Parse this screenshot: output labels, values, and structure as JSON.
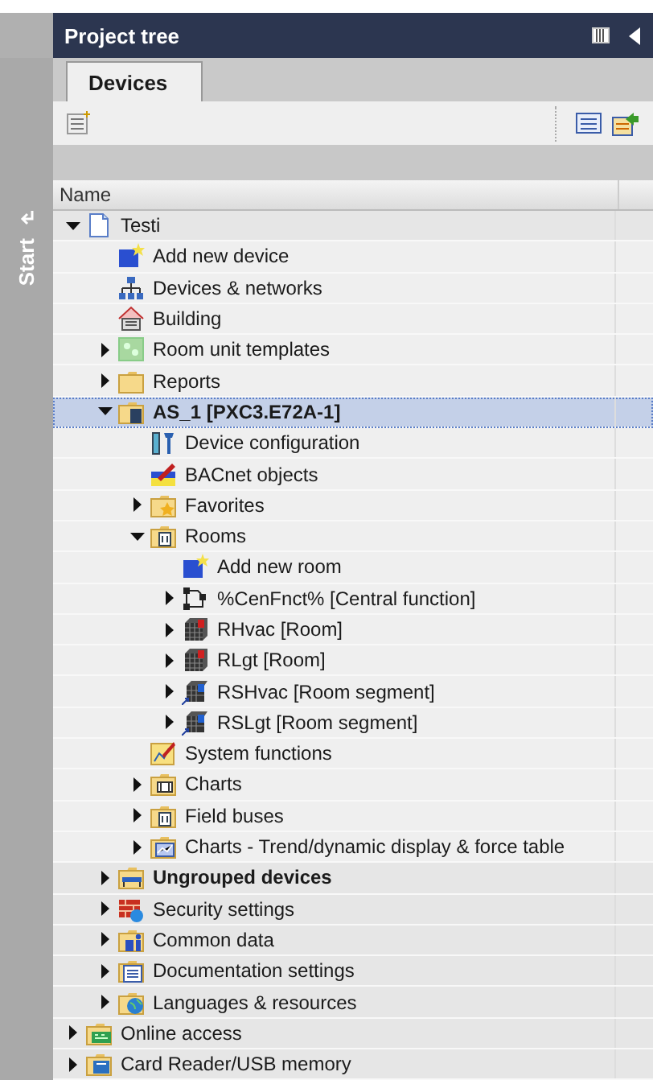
{
  "side_strip": {
    "label": "Start"
  },
  "panel": {
    "title": "Project tree"
  },
  "tabs": [
    {
      "label": "Devices",
      "selected": true
    }
  ],
  "tree": {
    "column": "Name",
    "items": [
      {
        "label": "Testi",
        "kind": "project",
        "expanded": true,
        "selected": false,
        "children": [
          {
            "label": "Add new device",
            "kind": "add",
            "selected": false
          },
          {
            "label": "Devices & networks",
            "kind": "network",
            "selected": false
          },
          {
            "label": "Building",
            "kind": "building",
            "selected": false
          },
          {
            "label": "Room unit templates",
            "kind": "templates",
            "expanded": false,
            "selected": false
          },
          {
            "label": "Reports",
            "kind": "folder",
            "expanded": false,
            "selected": false
          },
          {
            "label": "AS_1 [PXC3.E72A-1]",
            "kind": "device",
            "bold": true,
            "expanded": true,
            "selected": true,
            "children": [
              {
                "label": "Device configuration",
                "kind": "config",
                "selected": false
              },
              {
                "label": "BACnet objects",
                "kind": "bacnet",
                "selected": false
              },
              {
                "label": "Favorites",
                "kind": "favorites",
                "expanded": false,
                "selected": false
              },
              {
                "label": "Rooms",
                "kind": "rooms",
                "expanded": true,
                "selected": false,
                "children": [
                  {
                    "label": "Add new room",
                    "kind": "add",
                    "selected": false
                  },
                  {
                    "label": "%CenFnct% [Central function]",
                    "kind": "function",
                    "expanded": false,
                    "selected": false
                  },
                  {
                    "label": "RHvac [Room]",
                    "kind": "room",
                    "expanded": false,
                    "selected": false
                  },
                  {
                    "label": "RLgt [Room]",
                    "kind": "room",
                    "expanded": false,
                    "selected": false
                  },
                  {
                    "label": "RSHvac [Room segment]",
                    "kind": "segment",
                    "expanded": false,
                    "selected": false
                  },
                  {
                    "label": "RSLgt [Room segment]",
                    "kind": "segment",
                    "expanded": false,
                    "selected": false
                  }
                ]
              },
              {
                "label": "System functions",
                "kind": "sysfunc",
                "selected": false
              },
              {
                "label": "Charts",
                "kind": "charts",
                "expanded": false,
                "selected": false
              },
              {
                "label": "Field buses",
                "kind": "rooms",
                "expanded": false,
                "selected": false
              },
              {
                "label": "Charts - Trend/dynamic display & force table",
                "kind": "trend",
                "expanded": false,
                "selected": false
              }
            ]
          },
          {
            "label": "Ungrouped devices",
            "kind": "ungrouped",
            "bold": true,
            "expanded": false,
            "selected": false
          },
          {
            "label": "Security settings",
            "kind": "security",
            "expanded": false,
            "selected": false
          },
          {
            "label": "Common data",
            "kind": "common",
            "expanded": false,
            "selected": false
          },
          {
            "label": "Documentation settings",
            "kind": "docs",
            "expanded": false,
            "selected": false
          },
          {
            "label": "Languages & resources",
            "kind": "languages",
            "expanded": false,
            "selected": false
          }
        ]
      },
      {
        "label": "Online access",
        "kind": "online",
        "expanded": false,
        "selected": false
      },
      {
        "label": "Card Reader/USB memory",
        "kind": "usb",
        "expanded": false,
        "selected": false
      }
    ]
  }
}
